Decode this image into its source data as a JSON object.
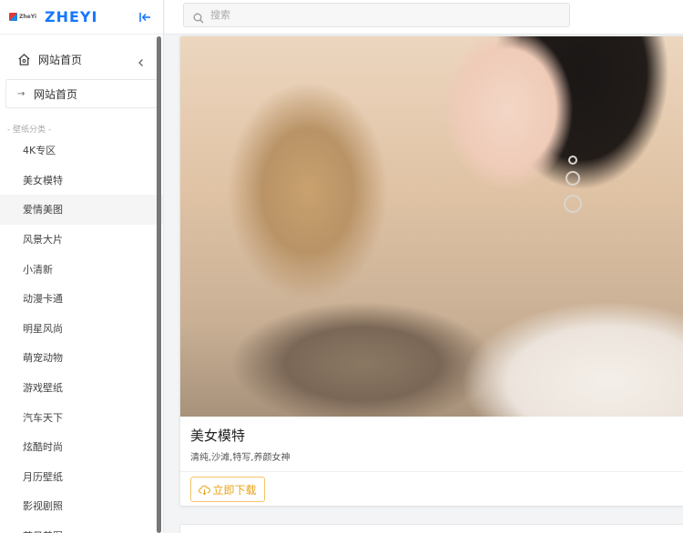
{
  "app": {
    "logo_small_text": "ZheYi",
    "logo_text": "ZHEYI"
  },
  "search": {
    "placeholder": "搜索",
    "value": ""
  },
  "sidebar": {
    "home_label": "网站首页",
    "submenu": [
      {
        "label": "网站首页"
      }
    ],
    "group_title": "- 壁纸分类 -",
    "categories": [
      {
        "label": "4K专区"
      },
      {
        "label": "美女模特"
      },
      {
        "label": "爱情美图"
      },
      {
        "label": "风景大片"
      },
      {
        "label": "小清新"
      },
      {
        "label": "动漫卡通"
      },
      {
        "label": "明星风尚"
      },
      {
        "label": "萌宠动物"
      },
      {
        "label": "游戏壁纸"
      },
      {
        "label": "汽车天下"
      },
      {
        "label": "炫酷时尚"
      },
      {
        "label": "月历壁纸"
      },
      {
        "label": "影视剧照"
      },
      {
        "label": "节日美图"
      }
    ]
  },
  "card": {
    "title": "美女模特",
    "tags": "清纯,沙滩,特写,养颜女神",
    "download_label": "立即下载",
    "image_alt": "woman-portrait-photo"
  },
  "colors": {
    "accent": "#1677ff",
    "download": "#e8a317"
  }
}
